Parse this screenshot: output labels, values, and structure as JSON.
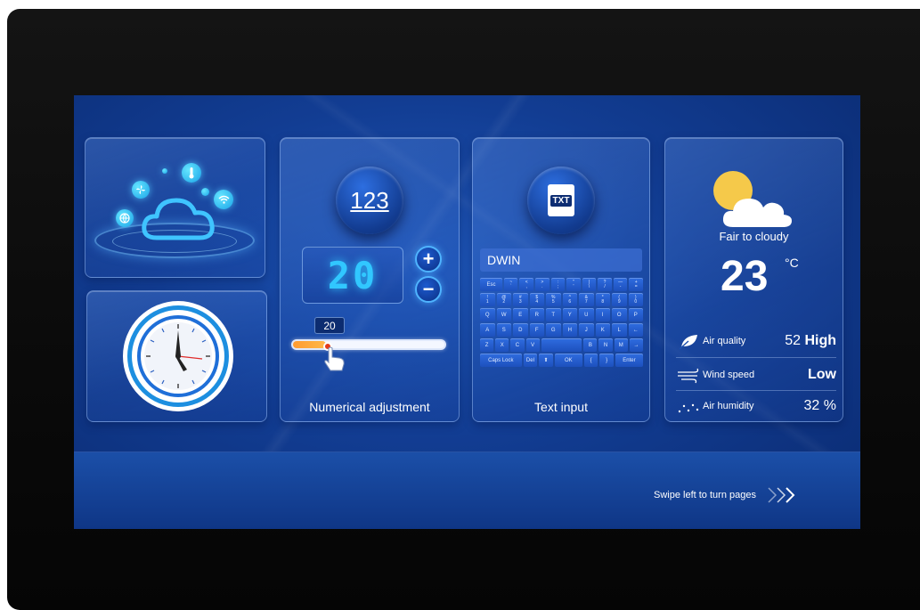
{
  "numeric_panel": {
    "badge_label": "123",
    "display_value": "20",
    "plus_label": "+",
    "minus_label": "−",
    "slider_value": "20",
    "slider_fraction": 0.22,
    "caption": "Numerical adjustment"
  },
  "text_panel": {
    "badge_label": "TXT",
    "field_value": "DWIN",
    "caption": "Text input",
    "keyboard": {
      "row1": [
        [
          "Esc",
          ""
        ],
        [
          "~",
          "`"
        ],
        [
          "<",
          ","
        ],
        [
          ">",
          "."
        ],
        [
          ":",
          ";"
        ],
        [
          "\"",
          "'"
        ],
        [
          "|",
          "\\"
        ],
        [
          "?",
          "/"
        ],
        [
          "—",
          "-"
        ],
        [
          "+",
          "="
        ]
      ],
      "row2": [
        [
          "!",
          "1"
        ],
        [
          "@",
          "2"
        ],
        [
          "#",
          "3"
        ],
        [
          "$",
          "4"
        ],
        [
          "%",
          "5"
        ],
        [
          "^",
          "6"
        ],
        [
          "&",
          "7"
        ],
        [
          "*",
          "8"
        ],
        [
          "(",
          "9"
        ],
        [
          ")",
          "0"
        ]
      ],
      "row3": [
        "Q",
        "W",
        "E",
        "R",
        "T",
        "Y",
        "U",
        "I",
        "O",
        "P"
      ],
      "row4": [
        "A",
        "S",
        "D",
        "F",
        "G",
        "H",
        "J",
        "K",
        "L",
        "←"
      ],
      "row5": [
        "Z",
        "X",
        "C",
        "V",
        "",
        "B",
        "N",
        "M",
        "→"
      ],
      "row6": [
        "Caps Lock",
        "Del",
        "⬆",
        "OK",
        "{",
        "}",
        "Enter"
      ]
    }
  },
  "weather_panel": {
    "description": "Fair to cloudy",
    "temperature": "23",
    "unit": "°C",
    "air_quality_label": "Air quality",
    "air_quality_value": "52",
    "air_quality_level": "High",
    "wind_label": "Wind speed",
    "wind_value": "Low",
    "humidity_label": "Air humidity",
    "humidity_value": "32 %"
  },
  "footer": {
    "swipe_text": "Swipe left to turn pages",
    "arrows": "≫"
  },
  "colors": {
    "screen_blue": "#123d93",
    "accent_cyan": "#31c7ff",
    "slider_orange": "#ff9b2f",
    "sun_yellow": "#f5c94a"
  }
}
